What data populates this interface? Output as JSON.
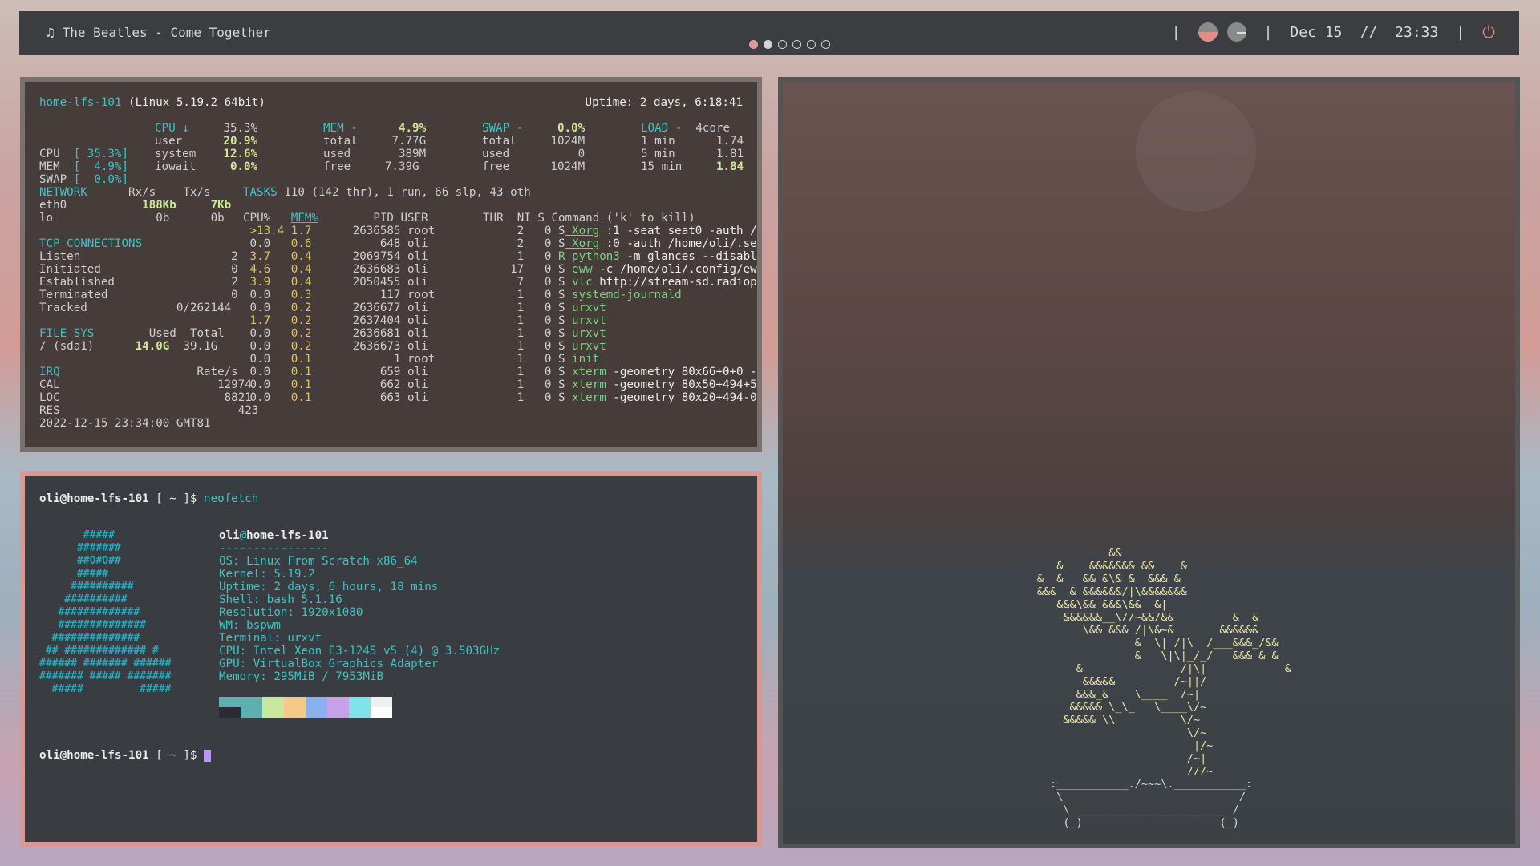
{
  "bar": {
    "song": "The Beatles - Come Together",
    "music_icon": "music-note-icon",
    "workspaces": [
      "active",
      "occupied",
      "empty",
      "empty",
      "empty",
      "empty"
    ],
    "sep1": "|",
    "date": "Dec 15",
    "sep_mid": "//",
    "time": "23:33",
    "sep3": "|",
    "power_icon": "power-icon"
  },
  "glances": {
    "host": "home-lfs-101",
    "os": " (Linux 5.19.2 64bit)",
    "uptime": "Uptime: 2 days, 6:18:41",
    "quick": {
      "cpu_label": "CPU",
      "cpu_pct": "[ 35.3%]",
      "mem_label": "MEM",
      "mem_pct": "[  4.9%]",
      "swap_label": "SWAP",
      "swap_pct": "[  0.0%]"
    },
    "cpu": {
      "label": "CPU ↓",
      "total": "35.3%",
      "user": "user",
      "user_v": "20.9%",
      "system": "system",
      "system_v": "12.6%",
      "iowait": "iowait",
      "iowait_v": "0.0%"
    },
    "mem": {
      "label": "MEM -",
      "pct": "4.9%",
      "total_l": "total",
      "total": "7.77G",
      "used_l": "used",
      "used": "389M",
      "free_l": "free",
      "free": "7.39G"
    },
    "swap": {
      "label": "SWAP -",
      "pct": "0.0%",
      "total_l": "total",
      "total": "1024M",
      "used_l": "used",
      "used": "0",
      "free_l": "free",
      "free": "1024M"
    },
    "load": {
      "label": "LOAD -",
      "cores": "4core",
      "l1": "1 min",
      "v1": "1.74",
      "l5": "5 min",
      "v5": "1.81",
      "l15": "15 min",
      "v15": "1.84"
    },
    "network": {
      "header": "NETWORK",
      "rx": "Rx/s",
      "tx": "Tx/s",
      "rows": [
        [
          "eth0",
          "188Kb",
          "7Kb"
        ],
        [
          "lo",
          "0b",
          "0b"
        ]
      ]
    },
    "tcp": {
      "header": "TCP CONNECTIONS",
      "rows": [
        [
          "Listen",
          "2"
        ],
        [
          "Initiated",
          "0"
        ],
        [
          "Established",
          "2"
        ],
        [
          "Terminated",
          "0"
        ],
        [
          "Tracked",
          "0/262144"
        ]
      ]
    },
    "fs": {
      "header": "FILE SYS",
      "used": "Used",
      "total": "Total",
      "row": [
        "/ (sda1)",
        "14.0G",
        "39.1G"
      ]
    },
    "irq": {
      "header": "IRQ",
      "rate": "Rate/s",
      "rows": [
        [
          "CAL",
          "12974"
        ],
        [
          "LOC",
          "8821"
        ],
        [
          "RES",
          "423"
        ]
      ]
    },
    "timestamp": "2022-12-15 23:34:00 GMT81",
    "tasks": {
      "label": "TASKS",
      "summary": " 110 (142 thr), 1 run, 66 slp, 43 oth"
    },
    "proc_header": {
      "cpu": "CPU%",
      "mem": "MEM%",
      "pid": "PID",
      "user": "USER",
      "thr": "THR",
      "ni": "NI",
      "s": "S",
      "cmd": "Command ('k' to kill)"
    },
    "processes": [
      [
        ">13.4",
        "1.7",
        "2636585",
        "root",
        "2",
        "0",
        "S",
        "Xorg",
        ":1 -seat seat0 -auth /"
      ],
      [
        "0.0",
        "0.6",
        "648",
        "oli",
        "2",
        "0",
        "S",
        "Xorg",
        ":0 -auth /home/oli/.se"
      ],
      [
        "3.7",
        "0.4",
        "2069754",
        "oli",
        "1",
        "0",
        "R",
        "python3",
        "-m glances --disabl"
      ],
      [
        "4.6",
        "0.4",
        "2636683",
        "oli",
        "17",
        "0",
        "S",
        "eww",
        "-c /home/oli/.config/ew"
      ],
      [
        "3.9",
        "0.4",
        "2050455",
        "oli",
        "7",
        "0",
        "S",
        "vlc",
        "http://stream-sd.radiop"
      ],
      [
        "0.0",
        "0.3",
        "117",
        "root",
        "1",
        "0",
        "S",
        "systemd-journald",
        ""
      ],
      [
        "0.0",
        "0.2",
        "2636677",
        "oli",
        "1",
        "0",
        "S",
        "urxvt",
        ""
      ],
      [
        "1.7",
        "0.2",
        "2637404",
        "oli",
        "1",
        "0",
        "S",
        "urxvt",
        ""
      ],
      [
        "0.0",
        "0.2",
        "2636681",
        "oli",
        "1",
        "0",
        "S",
        "urxvt",
        ""
      ],
      [
        "0.0",
        "0.2",
        "2636673",
        "oli",
        "1",
        "0",
        "S",
        "urxvt",
        ""
      ],
      [
        "0.0",
        "0.1",
        "1",
        "root",
        "1",
        "0",
        "S",
        "init",
        ""
      ],
      [
        "0.0",
        "0.1",
        "659",
        "oli",
        "1",
        "0",
        "S",
        "xterm",
        "-geometry 80x66+0+0 -"
      ],
      [
        "0.0",
        "0.1",
        "662",
        "oli",
        "1",
        "0",
        "S",
        "xterm",
        "-geometry 80x50+494+5"
      ],
      [
        "0.0",
        "0.1",
        "663",
        "oli",
        "1",
        "0",
        "S",
        "xterm",
        "-geometry 80x20+494-0"
      ]
    ]
  },
  "neofetch": {
    "prompt_user": "oli@home-lfs-101",
    "prompt_mid": " [ ~ ]$ ",
    "command": "neofetch",
    "title_user": "oli",
    "title_at": "@",
    "title_host": "home-lfs-101",
    "underline": "----------------",
    "info": [
      [
        "OS:",
        "Linux From Scratch x86_64"
      ],
      [
        "Kernel:",
        "5.19.2"
      ],
      [
        "Uptime:",
        "2 days, 6 hours, 18 mins"
      ],
      [
        "Shell:",
        "bash 5.1.16"
      ],
      [
        "Resolution:",
        "1920x1080"
      ],
      [
        "WM:",
        "bspwm"
      ],
      [
        "Terminal:",
        "urxvt"
      ],
      [
        "CPU:",
        "Intel Xeon E3-1245 v5 (4) @ 3.503GHz"
      ],
      [
        "GPU:",
        "VirtualBox Graphics Adapter"
      ],
      [
        "Memory:",
        "295MiB / 7953MiB"
      ]
    ],
    "palette_top": [
      "#5eb0b0",
      "#5eb0b0",
      "#c8e8a0",
      "#f4c98a",
      "#8ab0f0",
      "#c8a0e8",
      "#7fe4e8",
      "#f0f0f0"
    ],
    "palette_bottom": [
      "#2a2c34",
      "#5eb0b0",
      "#c8e8a0",
      "#f4c98a",
      "#8ab0f0",
      "#c8a0e8",
      "#7fe4e8",
      "#ffffff"
    ],
    "prompt2_user": "oli@home-lfs-101",
    "prompt2_mid": " [ ~ ]$ ",
    "logo": [
      "       #####",
      "      #######",
      "      ##O#O##",
      "      #####",
      "     ##########",
      "    ##########",
      "   #############",
      "   ##############",
      "  ##############",
      " ## ############# #",
      "###### ####### ######",
      "####### ##### #######",
      "  #####         #####"
    ]
  },
  "cbonsai": {
    "tree": [
      "                  &&",
      "          &    &&&&&&& &&    &",
      "       &  &   && &\\& &  &&& &",
      "       &&&  & &&&&&&/|\\&&&&&&&",
      "          &&&\\&& &&&\\&&  &|",
      "           &&&&&&__\\//~&&/&&         &  &",
      "              \\&& &&& /|\\&~&       &&&&&&",
      "                      &  \\| /|\\  /___&&&_/&&",
      "                      &   \\|\\|_/_/   &&& & &",
      "             &               /|\\|            &",
      "              &&&&&         /~||/",
      "             &&&_&    \\____  /~|",
      "            &&&&& \\_\\_   \\____\\/~",
      "           &&&&& \\\\          \\/~",
      "                              \\/~",
      "                               |/~",
      "                              /~|",
      "                              ///~"
    ],
    "pot": [
      "         :___________./~~~\\.___________:",
      "          \\                           /",
      "           \\_________________________/",
      "           (_)                     (_)"
    ]
  }
}
